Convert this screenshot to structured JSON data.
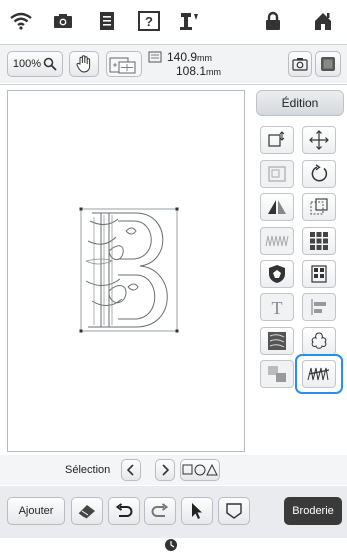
{
  "top_icons": [
    "wifi-icon",
    "camera-icon",
    "document-icon",
    "help-icon",
    "thread-icon",
    "lock-icon",
    "home-icon"
  ],
  "toolbar": {
    "zoom_label": "100%",
    "width_value": "140.9",
    "width_unit": "mm",
    "height_value": "108.1",
    "height_unit": "mm"
  },
  "panel": {
    "edit_tab": "Édition"
  },
  "selection": {
    "label": "Sélection"
  },
  "bottom": {
    "add_label": "Ajouter",
    "embroidery_label": "Broderie"
  },
  "canvas": {
    "letter": "B"
  },
  "colors": {
    "accent": "#2a8ef0",
    "dark_button": "#3a3a3a"
  }
}
